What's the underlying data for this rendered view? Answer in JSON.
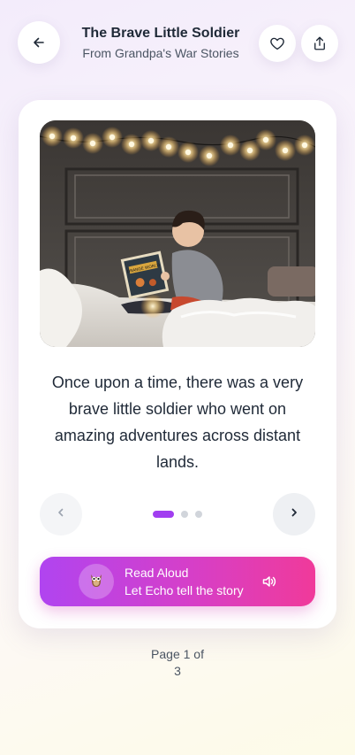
{
  "header": {
    "title": "The Brave Little Soldier",
    "subtitle": "From Grandpa's War Stories",
    "icons": {
      "back": "arrow-left-icon",
      "favorite": "heart-icon",
      "share": "share-icon"
    }
  },
  "story": {
    "image_description": "child reading a book on a bed under string lights",
    "book_title": "ORANGE WORLD",
    "text": "Once upon a time, there was a very brave little soldier who went on amazing adventures across distant lands."
  },
  "pager": {
    "total_pages": 3,
    "current_page": 1,
    "page_line1": "Page 1 of",
    "page_line2": "3",
    "prev_icon": "chevron-left-icon",
    "next_icon": "chevron-right-icon"
  },
  "read_aloud": {
    "title": "Read Aloud",
    "subtitle": "Let Echo tell the story",
    "avatar_icon": "owl-icon",
    "speaker_icon": "speaker-icon"
  },
  "colors": {
    "accent": "#a13ef0",
    "gradient_start": "#b044f0",
    "gradient_end": "#f03a9a"
  }
}
